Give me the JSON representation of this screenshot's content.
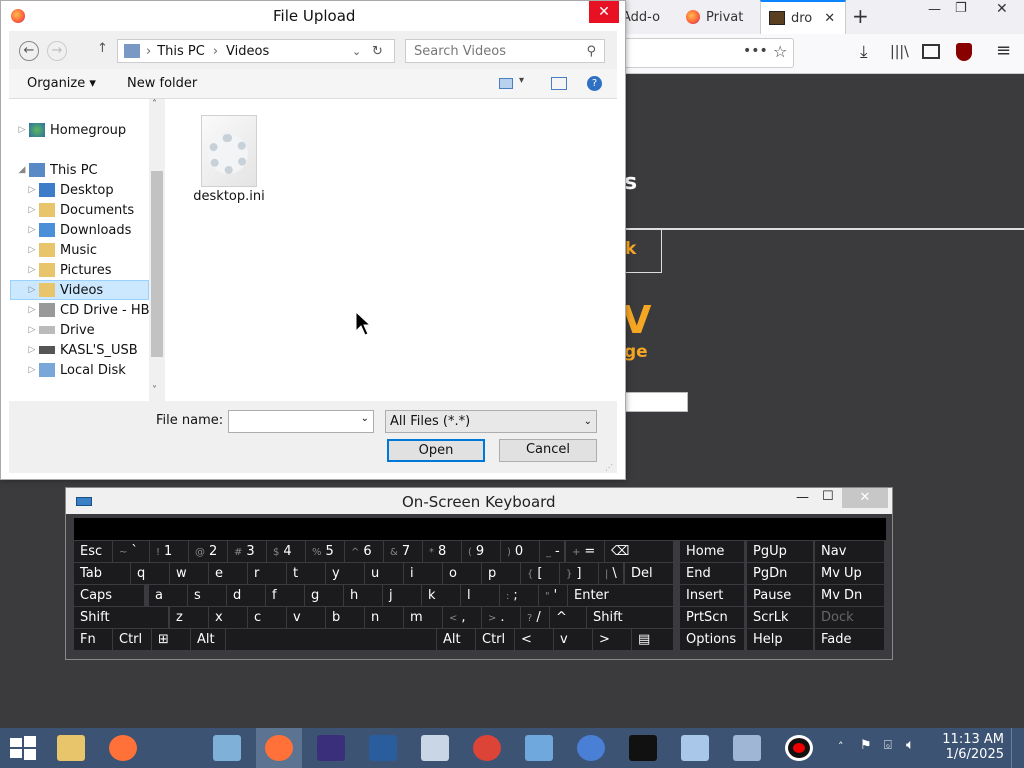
{
  "browser": {
    "tabs": [
      {
        "label": "Add-o"
      },
      {
        "label": "Privat"
      },
      {
        "label": "dro"
      }
    ],
    "new_tab_icon": "+",
    "page": {
      "heading_fragment": "s",
      "button_fragment": "k",
      "big_fragment": "V",
      "sub_fragment": "ge"
    }
  },
  "dialog": {
    "title": "File Upload",
    "breadcrumb": [
      "This PC",
      "Videos"
    ],
    "search_placeholder": "Search Videos",
    "toolbar": {
      "organize": "Organize ▾",
      "new_folder": "New folder"
    },
    "tree": [
      {
        "label": "Homegroup",
        "level": 0,
        "selected": false
      },
      {
        "label": "This PC",
        "level": 0,
        "selected": false
      },
      {
        "label": "Desktop",
        "level": 1,
        "selected": false
      },
      {
        "label": "Documents",
        "level": 1,
        "selected": false
      },
      {
        "label": "Downloads",
        "level": 1,
        "selected": false
      },
      {
        "label": "Music",
        "level": 1,
        "selected": false
      },
      {
        "label": "Pictures",
        "level": 1,
        "selected": false
      },
      {
        "label": "Videos",
        "level": 1,
        "selected": true
      },
      {
        "label": "CD Drive - HBC",
        "level": 1,
        "selected": false
      },
      {
        "label": "Drive",
        "level": 1,
        "selected": false
      },
      {
        "label": "KASL'S_USB",
        "level": 1,
        "selected": false
      },
      {
        "label": "Local Disk",
        "level": 1,
        "selected": false
      }
    ],
    "files": [
      {
        "name": "desktop.ini"
      }
    ],
    "file_name_label": "File name:",
    "file_name_value": "",
    "file_type": "All Files (*.*)",
    "open_label": "Open",
    "cancel_label": "Cancel"
  },
  "keyboard": {
    "title": "On-Screen Keyboard",
    "rows": [
      [
        {
          "l": "Esc"
        },
        {
          "s": "~",
          "l": "`"
        },
        {
          "s": "!",
          "l": "1"
        },
        {
          "s": "@",
          "l": "2"
        },
        {
          "s": "#",
          "l": "3"
        },
        {
          "s": "$",
          "l": "4"
        },
        {
          "s": "%",
          "l": "5"
        },
        {
          "s": "^",
          "l": "6"
        },
        {
          "s": "&",
          "l": "7"
        },
        {
          "s": "*",
          "l": "8"
        },
        {
          "s": "(",
          "l": "9"
        },
        {
          "s": ")",
          "l": "0"
        },
        {
          "s": "_",
          "l": "-"
        },
        {
          "s": "+",
          "l": "="
        },
        {
          "l": "⌫"
        }
      ],
      [
        {
          "l": "Tab"
        },
        {
          "l": "q"
        },
        {
          "l": "w"
        },
        {
          "l": "e"
        },
        {
          "l": "r"
        },
        {
          "l": "t"
        },
        {
          "l": "y"
        },
        {
          "l": "u"
        },
        {
          "l": "i"
        },
        {
          "l": "o"
        },
        {
          "l": "p"
        },
        {
          "s": "{",
          "l": "["
        },
        {
          "s": "}",
          "l": "]"
        },
        {
          "s": "|",
          "l": "\\"
        },
        {
          "l": "Del"
        }
      ],
      [
        {
          "l": "Caps"
        },
        {
          "l": "a"
        },
        {
          "l": "s"
        },
        {
          "l": "d"
        },
        {
          "l": "f"
        },
        {
          "l": "g"
        },
        {
          "l": "h"
        },
        {
          "l": "j"
        },
        {
          "l": "k"
        },
        {
          "l": "l"
        },
        {
          "s": ":",
          "l": ";"
        },
        {
          "s": "\"",
          "l": "'"
        },
        {
          "l": "Enter"
        }
      ],
      [
        {
          "l": "Shift"
        },
        {
          "l": "z"
        },
        {
          "l": "x"
        },
        {
          "l": "c"
        },
        {
          "l": "v"
        },
        {
          "l": "b"
        },
        {
          "l": "n"
        },
        {
          "l": "m"
        },
        {
          "s": "<",
          "l": ","
        },
        {
          "s": ">",
          "l": "."
        },
        {
          "s": "?",
          "l": "/"
        },
        {
          "l": "^"
        },
        {
          "l": "Shift"
        }
      ],
      [
        {
          "l": "Fn"
        },
        {
          "l": "Ctrl"
        },
        {
          "l": "⊞"
        },
        {
          "l": "Alt"
        },
        {
          "l": ""
        },
        {
          "l": "Alt"
        },
        {
          "l": "Ctrl"
        },
        {
          "l": "<"
        },
        {
          "l": "v"
        },
        {
          "l": ">"
        },
        {
          "l": "▤"
        }
      ]
    ],
    "right_keys": [
      [
        "Home",
        "PgUp",
        "Nav"
      ],
      [
        "End",
        "PgDn",
        "Mv Up"
      ],
      [
        "Insert",
        "Pause",
        "Mv Dn"
      ],
      [
        "PrtScn",
        "ScrLk",
        "Dock"
      ],
      [
        "Options",
        "Help",
        "Fade"
      ]
    ]
  },
  "taskbar": {
    "clock_time": "11:13 AM",
    "clock_date": "1/6/2025",
    "apps": [
      "start-icon",
      "file-explorer-icon",
      "firefox-icon",
      "runner-icon",
      "image-viewer-icon",
      "firefox-active-icon",
      "cpu-icon",
      "powershell-icon",
      "cleaner-icon",
      "chrome-icon",
      "control-panel-icon",
      "chromium-icon",
      "cmd-icon",
      "notepad-icon",
      "network-computer-icon",
      "record-icon"
    ]
  }
}
